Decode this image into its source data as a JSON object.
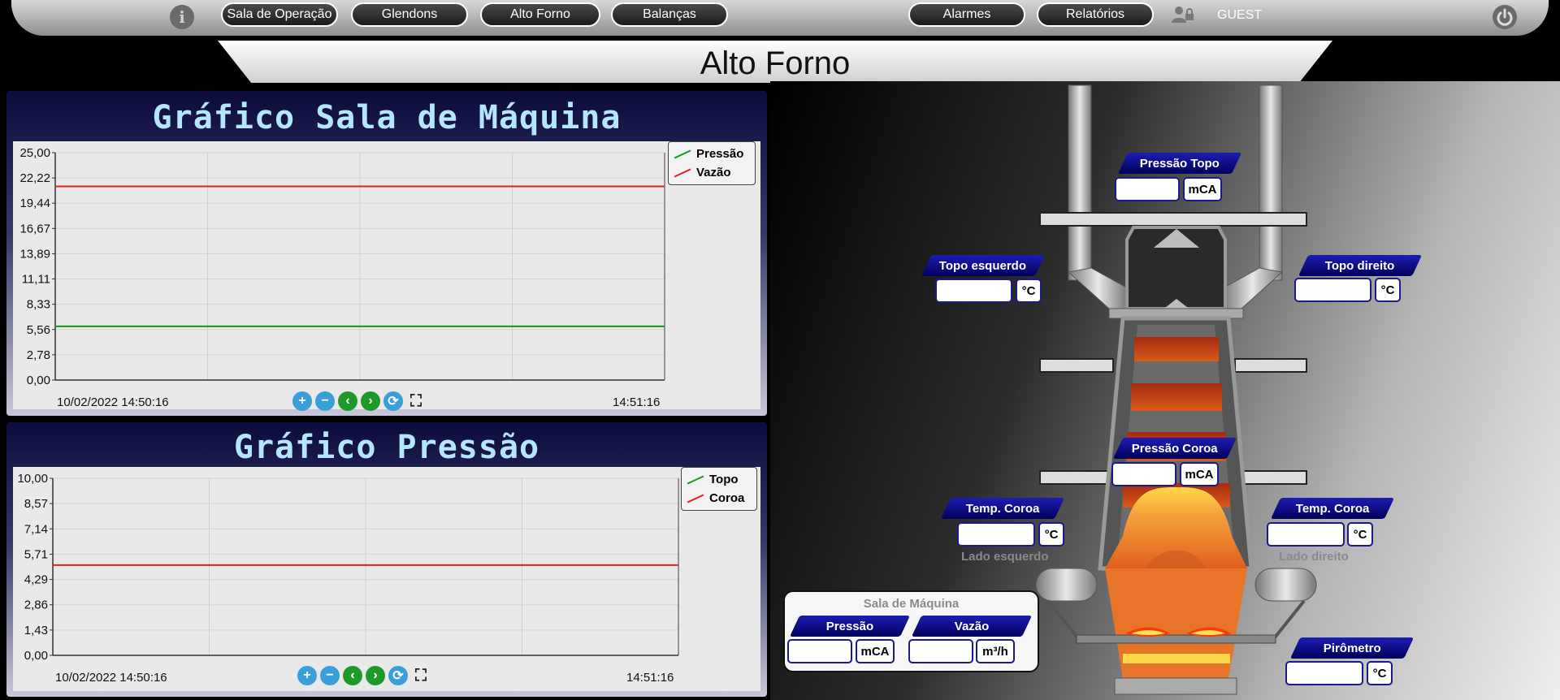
{
  "nav": {
    "info_icon": "i",
    "buttons": [
      "Sala de Operação",
      "Glendons",
      "Alto Forno",
      "Balanças",
      "Alarmes",
      "Relatórios"
    ],
    "user": "GUEST",
    "user_icon": "users-icon",
    "power_icon": "power-icon"
  },
  "page_title": "Alto Forno",
  "charts": [
    {
      "title": "Gráfico Sala de Máquina",
      "start": "10/02/2022 14:50:16",
      "end": "14:51:16",
      "legend": [
        "Pressão",
        "Vazão"
      ],
      "colors": {
        "Pressão": "#139a13",
        "Vazão": "#e01f1f"
      },
      "yticks": [
        "25,00",
        "22,22",
        "19,44",
        "16,67",
        "13,89",
        "11,11",
        "8,33",
        "5,56",
        "2,78",
        "0,00"
      ]
    },
    {
      "title": "Gráfico Pressão",
      "start": "10/02/2022 14:50:16",
      "end": "14:51:16",
      "legend": [
        "Topo",
        "Coroa"
      ],
      "colors": {
        "Topo": "#139a13",
        "Coroa": "#e01f1f"
      },
      "yticks": [
        "10,00",
        "8,57",
        "7,14",
        "5,71",
        "4,29",
        "2,86",
        "1,43",
        "0,00"
      ]
    }
  ],
  "chart_data": [
    {
      "type": "line",
      "title": "Gráfico Sala de Máquina",
      "x": [
        "10/02/2022 14:50:16",
        "14:51:16"
      ],
      "ylim": [
        0,
        25
      ],
      "series": [
        {
          "name": "Pressão",
          "values": [
            5.9,
            5.9
          ]
        },
        {
          "name": "Vazão",
          "values": [
            21.3,
            21.3
          ]
        }
      ]
    },
    {
      "type": "line",
      "title": "Gráfico Pressão",
      "x": [
        "10/02/2022 14:50:16",
        "14:51:16"
      ],
      "ylim": [
        0,
        10
      ],
      "series": [
        {
          "name": "Coroa",
          "values": [
            5.1,
            5.1
          ]
        }
      ]
    }
  ],
  "furnace": {
    "pressao_topo": {
      "label": "Pressão Topo",
      "unit": "mCA"
    },
    "topo_esquerdo": {
      "label": "Topo esquerdo",
      "unit": "°C"
    },
    "topo_direito": {
      "label": "Topo direito",
      "unit": "°C"
    },
    "pressao_coroa": {
      "label": "Pressão Coroa",
      "unit": "mCA"
    },
    "temp_coroa_esq": {
      "label": "Temp. Coroa",
      "unit": "°C",
      "sub": "Lado esquerdo"
    },
    "temp_coroa_dir": {
      "label": "Temp. Coroa",
      "unit": "°C",
      "sub": "Lado direito"
    },
    "pirometro": {
      "label": "Pirômetro",
      "unit": "°C"
    },
    "sala": {
      "title": "Sala de Máquina",
      "pressao": {
        "label": "Pressão",
        "unit": "mCA"
      },
      "vazao": {
        "label": "Vazão",
        "unit": "m³/h"
      }
    }
  }
}
